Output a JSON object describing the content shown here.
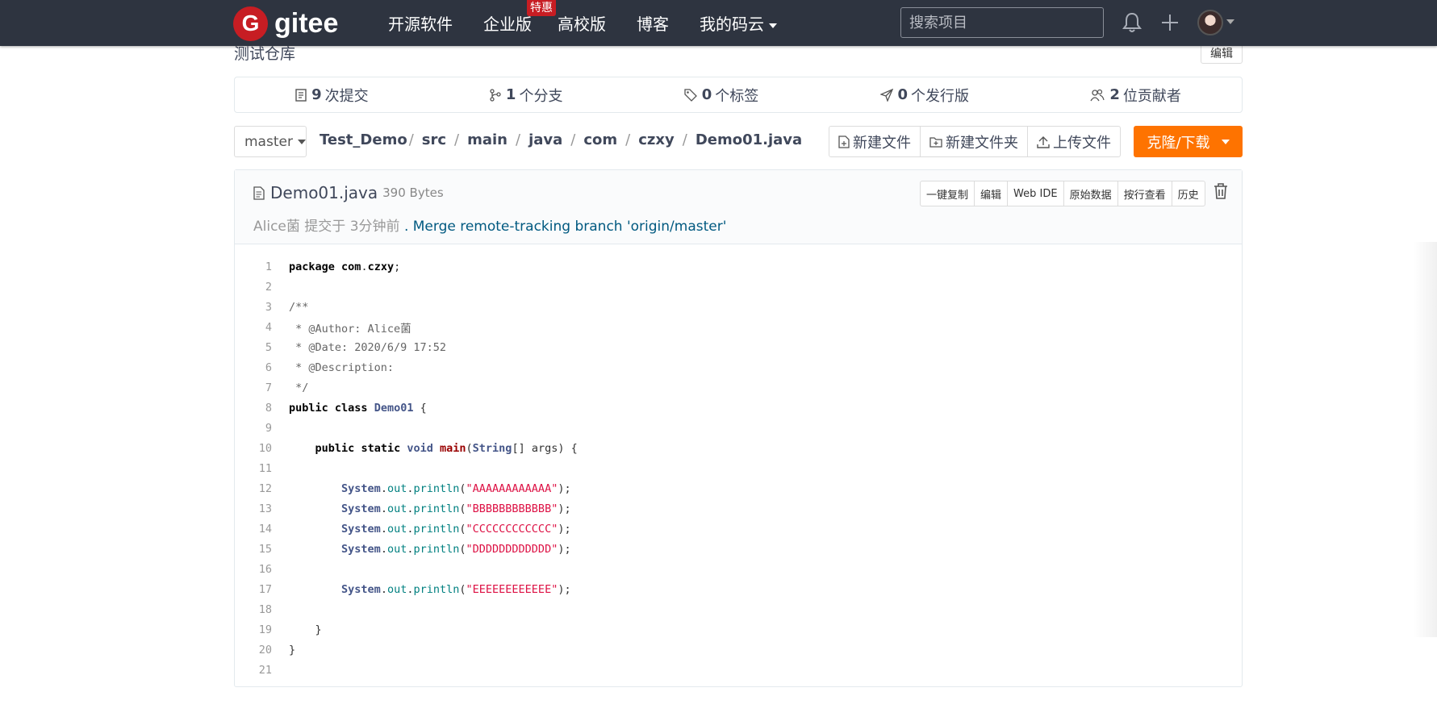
{
  "nav": {
    "logo_letter": "G",
    "logo_text": "gitee",
    "items": [
      {
        "label": "开源软件"
      },
      {
        "label": "企业版",
        "badge": "特惠"
      },
      {
        "label": "高校版"
      },
      {
        "label": "博客"
      },
      {
        "label": "我的码云"
      }
    ],
    "search_placeholder": "搜索项目"
  },
  "repo": {
    "description": "测试仓库",
    "edit_label": "编辑",
    "stats": [
      {
        "count": "9",
        "label": "次提交",
        "icon": "commit-icon"
      },
      {
        "count": "1",
        "label": "个分支",
        "icon": "branch-icon"
      },
      {
        "count": "0",
        "label": "个标签",
        "icon": "tag-icon"
      },
      {
        "count": "0",
        "label": "个发行版",
        "icon": "release-icon"
      },
      {
        "count": "2",
        "label": "位贡献者",
        "icon": "contributors-icon"
      }
    ]
  },
  "toolbar": {
    "branch": "master",
    "breadcrumb": [
      "Test_Demo",
      "src",
      "main",
      "java",
      "com",
      "czxy",
      "Demo01.java"
    ],
    "new_file": "新建文件",
    "new_folder": "新建文件夹",
    "upload": "上传文件",
    "clone": "克隆/下载"
  },
  "file": {
    "name": "Demo01.java",
    "size": "390 Bytes",
    "author": "Alice菌",
    "commit_prefix": "提交于",
    "commit_time": "3分钟前",
    "commit_sep": ".",
    "commit_message": "Merge remote-tracking branch 'origin/master'",
    "actions": [
      "一键复制",
      "编辑",
      "Web IDE",
      "原始数据",
      "按行查看",
      "历史"
    ]
  },
  "code_lines": [
    "package com.czxy;",
    "",
    "/**",
    " * @Author: Alice菌",
    " * @Date: 2020/6/9 17:52",
    " * @Description:",
    " */",
    "public class Demo01 {",
    "",
    "    public static void main(String[] args) {",
    "",
    "        System.out.println(\"AAAAAAAAAAAA\");",
    "        System.out.println(\"BBBBBBBBBBBB\");",
    "        System.out.println(\"CCCCCCCCCCCC\");",
    "        System.out.println(\"DDDDDDDDDDDD\");",
    "",
    "        System.out.println(\"EEEEEEEEEEEE\");",
    "",
    "    }",
    "}",
    ""
  ]
}
